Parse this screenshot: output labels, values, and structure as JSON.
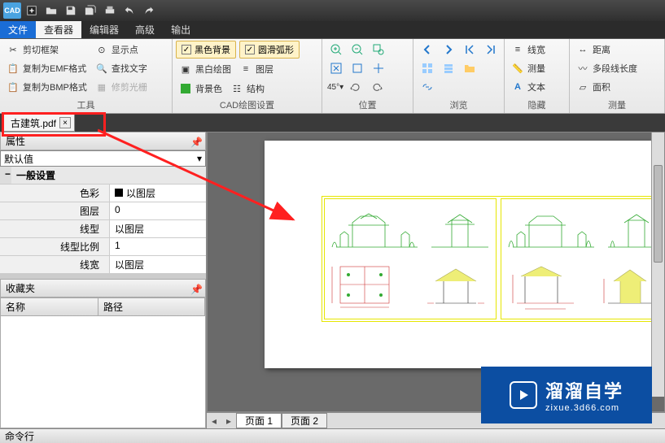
{
  "app": {
    "icon_label": "CAD"
  },
  "menus": {
    "file": "文件",
    "viewer": "查看器",
    "editor": "编辑器",
    "advanced": "高级",
    "output": "输出"
  },
  "ribbon": {
    "tools": {
      "label": "工具",
      "crop_frame": "剪切框架",
      "copy_emf": "复制为EMF格式",
      "copy_bmp": "复制为BMP格式",
      "show_points": "显示点",
      "find_text": "查找文字",
      "trim_raster": "修剪光栅"
    },
    "cad_settings": {
      "label": "CAD绘图设置",
      "black_bg": "黑色背景",
      "smooth_arc": "圆滑弧形",
      "bw_draw": "黑白绘图",
      "layers": "图层",
      "bg_color": "背景色",
      "structure": "结构"
    },
    "position": {
      "label": "位置"
    },
    "browse": {
      "label": "浏览"
    },
    "hide": {
      "label": "隐藏",
      "linewidth": "线宽",
      "measure": "测量",
      "text": "文本"
    },
    "measure": {
      "label": "测量",
      "distance": "距离",
      "polyline_len": "多段线长度",
      "area": "面积"
    }
  },
  "doc": {
    "tab_name": "古建筑.pdf"
  },
  "properties": {
    "panel_title": "属性",
    "combo_value": "默认值",
    "section_general": "一般设置",
    "rows": {
      "color_k": "色彩",
      "color_v": "以图层",
      "layer_k": "图层",
      "layer_v": "0",
      "linetype_k": "线型",
      "linetype_v": "以图层",
      "ltscale_k": "线型比例",
      "ltscale_v": "1",
      "lineweight_k": "线宽",
      "lineweight_v": "以图层"
    }
  },
  "favorites": {
    "panel_title": "收藏夹",
    "col_name": "名称",
    "col_path": "路径"
  },
  "pages": {
    "p1": "页面 1",
    "p2": "页面 2"
  },
  "status": {
    "cmdline": "命令行"
  },
  "watermark": {
    "brand": "溜溜自学",
    "url": "zixue.3d66.com"
  },
  "chart_data": null
}
